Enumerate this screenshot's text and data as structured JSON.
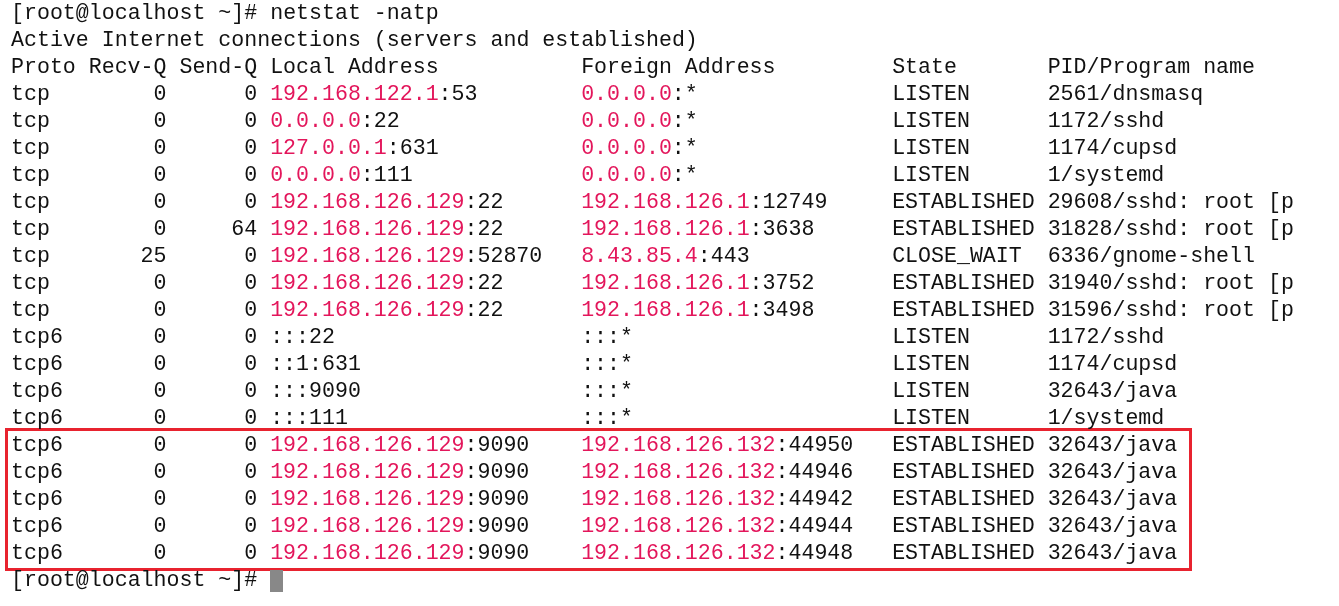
{
  "terminal": {
    "command_line": "[root@localhost ~]# netstat -natp",
    "heading": "Active Internet connections (servers and established)",
    "columns": [
      "Proto",
      "Recv-Q",
      "Send-Q",
      "Local Address",
      "Foreign Address",
      "State",
      "PID/Program name"
    ],
    "rows": [
      {
        "proto": "tcp",
        "recv_q": "0",
        "send_q": "0",
        "local": {
          "host": "192.168.122.1",
          "port": ":53"
        },
        "foreign": {
          "host": "0.0.0.0",
          "port": ":*"
        },
        "state": "LISTEN",
        "program": "2561/dnsmasq",
        "highlighted": false
      },
      {
        "proto": "tcp",
        "recv_q": "0",
        "send_q": "0",
        "local": {
          "host": "0.0.0.0",
          "port": ":22"
        },
        "foreign": {
          "host": "0.0.0.0",
          "port": ":*"
        },
        "state": "LISTEN",
        "program": "1172/sshd",
        "highlighted": false
      },
      {
        "proto": "tcp",
        "recv_q": "0",
        "send_q": "0",
        "local": {
          "host": "127.0.0.1",
          "port": ":631"
        },
        "foreign": {
          "host": "0.0.0.0",
          "port": ":*"
        },
        "state": "LISTEN",
        "program": "1174/cupsd",
        "highlighted": false
      },
      {
        "proto": "tcp",
        "recv_q": "0",
        "send_q": "0",
        "local": {
          "host": "0.0.0.0",
          "port": ":111"
        },
        "foreign": {
          "host": "0.0.0.0",
          "port": ":*"
        },
        "state": "LISTEN",
        "program": "1/systemd",
        "highlighted": false
      },
      {
        "proto": "tcp",
        "recv_q": "0",
        "send_q": "0",
        "local": {
          "host": "192.168.126.129",
          "port": ":22"
        },
        "foreign": {
          "host": "192.168.126.1",
          "port": ":12749"
        },
        "state": "ESTABLISHED",
        "program": "29608/sshd: root [p",
        "highlighted": false
      },
      {
        "proto": "tcp",
        "recv_q": "0",
        "send_q": "64",
        "local": {
          "host": "192.168.126.129",
          "port": ":22"
        },
        "foreign": {
          "host": "192.168.126.1",
          "port": ":3638"
        },
        "state": "ESTABLISHED",
        "program": "31828/sshd: root [p",
        "highlighted": false
      },
      {
        "proto": "tcp",
        "recv_q": "25",
        "send_q": "0",
        "local": {
          "host": "192.168.126.129",
          "port": ":52870"
        },
        "foreign": {
          "host": "8.43.85.4",
          "port": ":443"
        },
        "state": "CLOSE_WAIT",
        "program": "6336/gnome-shell",
        "highlighted": false
      },
      {
        "proto": "tcp",
        "recv_q": "0",
        "send_q": "0",
        "local": {
          "host": "192.168.126.129",
          "port": ":22"
        },
        "foreign": {
          "host": "192.168.126.1",
          "port": ":3752"
        },
        "state": "ESTABLISHED",
        "program": "31940/sshd: root [p",
        "highlighted": false
      },
      {
        "proto": "tcp",
        "recv_q": "0",
        "send_q": "0",
        "local": {
          "host": "192.168.126.129",
          "port": ":22"
        },
        "foreign": {
          "host": "192.168.126.1",
          "port": ":3498"
        },
        "state": "ESTABLISHED",
        "program": "31596/sshd: root [p",
        "highlighted": false
      },
      {
        "proto": "tcp6",
        "recv_q": "0",
        "send_q": "0",
        "local": {
          "port": ":::22"
        },
        "foreign": {
          "port": ":::*"
        },
        "state": "LISTEN",
        "program": "1172/sshd",
        "highlighted": false
      },
      {
        "proto": "tcp6",
        "recv_q": "0",
        "send_q": "0",
        "local": {
          "port": "::1:631"
        },
        "foreign": {
          "port": ":::*"
        },
        "state": "LISTEN",
        "program": "1174/cupsd",
        "highlighted": false
      },
      {
        "proto": "tcp6",
        "recv_q": "0",
        "send_q": "0",
        "local": {
          "port": ":::9090"
        },
        "foreign": {
          "port": ":::*"
        },
        "state": "LISTEN",
        "program": "32643/java",
        "highlighted": false
      },
      {
        "proto": "tcp6",
        "recv_q": "0",
        "send_q": "0",
        "local": {
          "port": ":::111"
        },
        "foreign": {
          "port": ":::*"
        },
        "state": "LISTEN",
        "program": "1/systemd",
        "highlighted": false
      },
      {
        "proto": "tcp6",
        "recv_q": "0",
        "send_q": "0",
        "local": {
          "host": "192.168.126.129",
          "port": ":9090"
        },
        "foreign": {
          "host": "192.168.126.132",
          "port": ":44950"
        },
        "state": "ESTABLISHED",
        "program": "32643/java",
        "highlighted": true
      },
      {
        "proto": "tcp6",
        "recv_q": "0",
        "send_q": "0",
        "local": {
          "host": "192.168.126.129",
          "port": ":9090"
        },
        "foreign": {
          "host": "192.168.126.132",
          "port": ":44946"
        },
        "state": "ESTABLISHED",
        "program": "32643/java",
        "highlighted": true
      },
      {
        "proto": "tcp6",
        "recv_q": "0",
        "send_q": "0",
        "local": {
          "host": "192.168.126.129",
          "port": ":9090"
        },
        "foreign": {
          "host": "192.168.126.132",
          "port": ":44942"
        },
        "state": "ESTABLISHED",
        "program": "32643/java",
        "highlighted": true
      },
      {
        "proto": "tcp6",
        "recv_q": "0",
        "send_q": "0",
        "local": {
          "host": "192.168.126.129",
          "port": ":9090"
        },
        "foreign": {
          "host": "192.168.126.132",
          "port": ":44944"
        },
        "state": "ESTABLISHED",
        "program": "32643/java",
        "highlighted": true
      },
      {
        "proto": "tcp6",
        "recv_q": "0",
        "send_q": "0",
        "local": {
          "host": "192.168.126.129",
          "port": ":9090"
        },
        "foreign": {
          "host": "192.168.126.132",
          "port": ":44948"
        },
        "state": "ESTABLISHED",
        "program": "32643/java",
        "highlighted": true
      }
    ],
    "prompt": "[root@localhost ~]#"
  }
}
